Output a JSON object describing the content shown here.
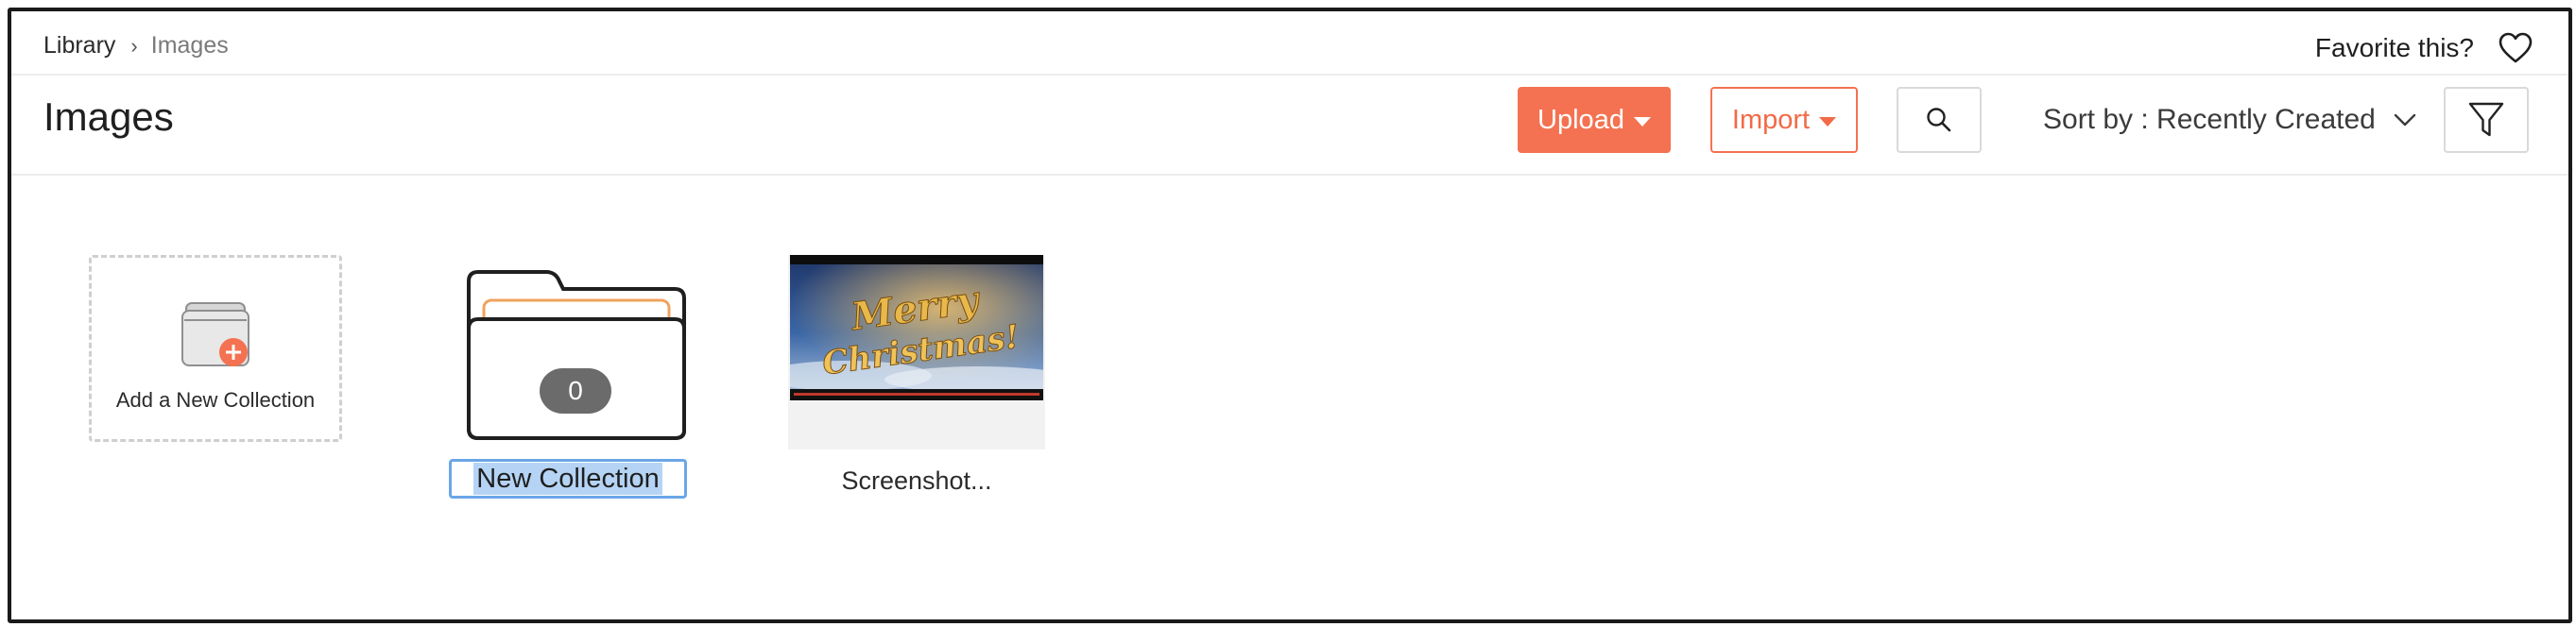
{
  "breadcrumb": {
    "root": "Library",
    "separator": "›",
    "current": "Images"
  },
  "favorite": {
    "label": "Favorite this?",
    "icon": "heart-outline-icon"
  },
  "header": {
    "title": "Images",
    "upload_label": "Upload",
    "import_label": "Import",
    "sort_label": "Sort by : Recently Created"
  },
  "tiles": {
    "add_collection_label": "Add a New Collection",
    "folder": {
      "count": "0",
      "name": "New Collection"
    },
    "image": {
      "caption": "Screenshot...",
      "thumbnail_text": "Merry Christmas!"
    }
  },
  "colors": {
    "accent": "#f47251",
    "selection": "#b5d4f5",
    "focus": "#6aa6e8"
  }
}
